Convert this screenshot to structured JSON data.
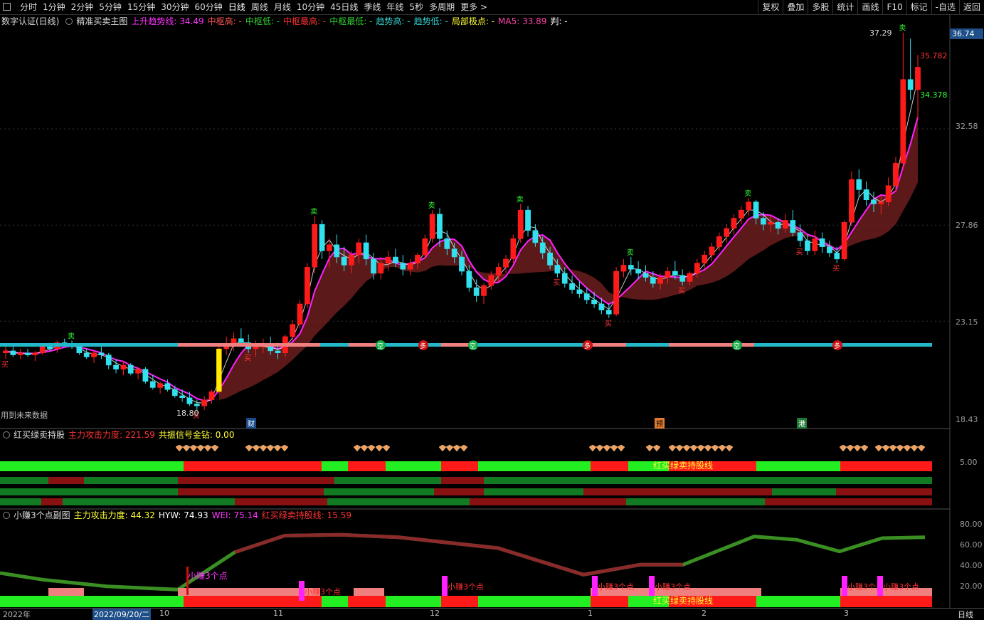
{
  "toolbar": {
    "timeframes": [
      "分时",
      "1分钟",
      "2分钟",
      "5分钟",
      "15分钟",
      "30分钟",
      "60分钟",
      "日线",
      "周线",
      "月线",
      "10分钟",
      "45日线",
      "季线",
      "年线",
      "5秒",
      "多周期",
      "更多 >"
    ],
    "active": "日线",
    "right_items": [
      "复权",
      "叠加",
      "多股",
      "统计",
      "画线",
      "F10",
      "标记",
      "-自选",
      "返回"
    ]
  },
  "main_header": {
    "stock": "数字认证(日线)",
    "indicator": "精准买卖主图",
    "fields": [
      {
        "label": "上升趋势线: 34.49",
        "color": "#ff33ff"
      },
      {
        "label": "中枢高: -",
        "color": "#ff5555"
      },
      {
        "label": "中枢低: -",
        "color": "#33cc33"
      },
      {
        "label": "中枢最高: -",
        "color": "#ff3333"
      },
      {
        "label": "中枢最低: -",
        "color": "#33cc33"
      },
      {
        "label": "趋势高: -",
        "color": "#33cccc"
      },
      {
        "label": "趋势低: -",
        "color": "#33cccc"
      },
      {
        "label": "局部极点: -",
        "color": "#ffff33"
      },
      {
        "label": "MA5: 33.89",
        "color": "#ff44aa"
      },
      {
        "label": "判: -",
        "color": "#ffffff"
      }
    ]
  },
  "main_axis": {
    "current": "36.74",
    "ticks": [
      "32.58",
      "27.86",
      "23.15",
      "18.43"
    ],
    "high_label": "37.29",
    "low_label": "18.80",
    "level_1": "35.782",
    "level_2": "34.378"
  },
  "main_notes": {
    "future_data": "用到未来数据",
    "event_1": "财",
    "event_2": "预",
    "event_3": "港"
  },
  "signal_labels": {
    "buy": "买",
    "sell": "卖",
    "empty": "空",
    "long": "多"
  },
  "sub1_header": {
    "name": "红买绿卖持股",
    "f1": "主力攻击力度: 221.59",
    "f2": "共振信号金钻: 0.00",
    "axis": "5.00",
    "band_label": "红买绿卖持股线"
  },
  "sub2_header": {
    "name": "小赚3个点副图",
    "f1": "主力攻击力度: 44.32",
    "f2": "HYW: 74.93",
    "f3": "WEI: 75.14",
    "f4": "红买绿卖持股线: 15.59",
    "ticks": [
      "80.00",
      "60.00",
      "40.00",
      "20.00"
    ],
    "tag": "小赚3个点",
    "band_label": "红买绿卖持股线"
  },
  "date_bar": {
    "year": "2022年",
    "cursor": "2022/09/20/二",
    "months": [
      "10",
      "11",
      "12",
      "1",
      "2",
      "3"
    ],
    "right": "日线"
  },
  "chart_data": {
    "type": "candlestick",
    "ohlc": [
      [
        21.6,
        21.9,
        21.3,
        21.7
      ],
      [
        21.7,
        21.9,
        21.4,
        21.5
      ],
      [
        21.5,
        21.8,
        21.3,
        21.6
      ],
      [
        21.6,
        21.8,
        21.4,
        21.5
      ],
      [
        21.5,
        21.7,
        21.2,
        21.6
      ],
      [
        21.6,
        22.0,
        21.5,
        21.9
      ],
      [
        21.9,
        22.1,
        21.7,
        21.8
      ],
      [
        21.8,
        22.2,
        21.6,
        22.1
      ],
      [
        22.1,
        22.3,
        21.9,
        22.0
      ],
      [
        22.0,
        22.2,
        21.8,
        21.9
      ],
      [
        21.9,
        22.0,
        21.5,
        21.6
      ],
      [
        21.6,
        21.8,
        21.3,
        21.4
      ],
      [
        21.4,
        21.7,
        21.1,
        21.6
      ],
      [
        21.6,
        21.9,
        21.3,
        21.5
      ],
      [
        21.5,
        21.6,
        20.8,
        21.0
      ],
      [
        21.0,
        21.3,
        20.6,
        20.8
      ],
      [
        20.8,
        21.2,
        20.5,
        21.0
      ],
      [
        21.0,
        21.1,
        20.5,
        20.6
      ],
      [
        20.6,
        20.9,
        20.3,
        20.8
      ],
      [
        20.8,
        20.9,
        20.1,
        20.2
      ],
      [
        20.2,
        20.5,
        19.8,
        19.9
      ],
      [
        19.9,
        20.2,
        19.6,
        20.1
      ],
      [
        20.1,
        20.3,
        19.7,
        19.8
      ],
      [
        19.8,
        20.0,
        19.4,
        19.5
      ],
      [
        19.5,
        19.8,
        19.2,
        19.4
      ],
      [
        19.4,
        19.7,
        19.0,
        19.1
      ],
      [
        19.1,
        19.3,
        18.8,
        19.0
      ],
      [
        19.0,
        19.5,
        18.8,
        19.3
      ],
      [
        19.3,
        19.8,
        19.1,
        19.7
      ],
      [
        19.7,
        22.0,
        19.6,
        21.8
      ],
      [
        21.8,
        22.4,
        21.5,
        22.0
      ],
      [
        22.0,
        22.6,
        21.7,
        22.3
      ],
      [
        22.3,
        22.8,
        21.9,
        22.1
      ],
      [
        22.1,
        22.5,
        21.6,
        21.8
      ],
      [
        21.8,
        22.2,
        21.4,
        21.9
      ],
      [
        21.9,
        22.3,
        21.6,
        22.0
      ],
      [
        22.0,
        22.4,
        21.5,
        21.7
      ],
      [
        21.7,
        22.1,
        21.3,
        21.6
      ],
      [
        21.6,
        22.5,
        21.4,
        22.4
      ],
      [
        22.4,
        23.2,
        22.2,
        23.0
      ],
      [
        23.0,
        24.2,
        22.8,
        24.0
      ],
      [
        24.0,
        26.0,
        23.8,
        25.8
      ],
      [
        25.8,
        28.3,
        25.5,
        27.9
      ],
      [
        27.9,
        28.1,
        26.2,
        26.6
      ],
      [
        26.6,
        27.2,
        25.8,
        26.9
      ],
      [
        26.9,
        27.4,
        26.0,
        26.3
      ],
      [
        26.3,
        26.8,
        25.6,
        25.9
      ],
      [
        25.9,
        26.6,
        25.5,
        26.4
      ],
      [
        26.4,
        27.2,
        26.0,
        27.0
      ],
      [
        27.0,
        27.4,
        25.9,
        26.2
      ],
      [
        26.2,
        26.5,
        25.2,
        25.5
      ],
      [
        25.5,
        26.3,
        25.2,
        26.0
      ],
      [
        26.0,
        26.6,
        25.6,
        26.3
      ],
      [
        26.3,
        26.7,
        25.8,
        26.0
      ],
      [
        26.0,
        26.4,
        25.4,
        25.7
      ],
      [
        25.7,
        26.2,
        25.4,
        26.0
      ],
      [
        26.0,
        26.5,
        25.7,
        26.4
      ],
      [
        26.4,
        27.4,
        26.2,
        27.2
      ],
      [
        27.2,
        28.6,
        27.0,
        28.4
      ],
      [
        28.4,
        28.7,
        26.8,
        27.2
      ],
      [
        27.2,
        27.6,
        26.4,
        26.7
      ],
      [
        26.7,
        27.0,
        26.0,
        26.3
      ],
      [
        26.3,
        26.6,
        25.4,
        25.6
      ],
      [
        25.6,
        25.9,
        24.6,
        24.8
      ],
      [
        24.8,
        25.2,
        24.1,
        24.4
      ],
      [
        24.4,
        25.0,
        24.0,
        24.9
      ],
      [
        24.9,
        25.6,
        24.7,
        25.4
      ],
      [
        25.4,
        26.0,
        25.1,
        25.8
      ],
      [
        25.8,
        26.4,
        25.5,
        26.2
      ],
      [
        26.2,
        27.4,
        26.0,
        27.2
      ],
      [
        27.2,
        28.9,
        27.0,
        28.6
      ],
      [
        28.6,
        28.8,
        27.3,
        27.6
      ],
      [
        27.6,
        27.9,
        26.8,
        27.0
      ],
      [
        27.0,
        27.3,
        26.2,
        26.5
      ],
      [
        26.5,
        26.8,
        25.7,
        25.9
      ],
      [
        25.9,
        26.2,
        25.3,
        25.5
      ],
      [
        25.5,
        25.8,
        24.8,
        25.0
      ],
      [
        25.0,
        25.4,
        24.5,
        24.7
      ],
      [
        24.7,
        25.1,
        24.3,
        24.5
      ],
      [
        24.5,
        24.8,
        24.0,
        24.2
      ],
      [
        24.2,
        24.6,
        23.8,
        24.0
      ],
      [
        24.0,
        24.3,
        23.5,
        23.7
      ],
      [
        23.7,
        24.0,
        23.3,
        23.5
      ],
      [
        23.5,
        25.8,
        23.4,
        25.6
      ],
      [
        25.6,
        26.2,
        25.3,
        25.9
      ],
      [
        25.9,
        26.3,
        25.4,
        25.7
      ],
      [
        25.7,
        26.1,
        25.2,
        25.5
      ],
      [
        25.5,
        25.9,
        25.1,
        25.3
      ],
      [
        25.3,
        25.6,
        24.8,
        25.0
      ],
      [
        25.0,
        25.5,
        24.7,
        25.3
      ],
      [
        25.3,
        25.8,
        25.0,
        25.6
      ],
      [
        25.6,
        26.1,
        25.2,
        25.4
      ],
      [
        25.4,
        25.7,
        24.9,
        25.1
      ],
      [
        25.1,
        25.6,
        24.9,
        25.5
      ],
      [
        25.5,
        26.2,
        25.3,
        26.0
      ],
      [
        26.0,
        26.6,
        25.7,
        26.4
      ],
      [
        26.4,
        27.0,
        26.1,
        26.8
      ],
      [
        26.8,
        27.5,
        26.6,
        27.3
      ],
      [
        27.3,
        27.9,
        27.0,
        27.7
      ],
      [
        27.7,
        28.4,
        27.4,
        28.2
      ],
      [
        28.2,
        28.8,
        27.9,
        28.6
      ],
      [
        28.6,
        29.2,
        28.3,
        29.0
      ],
      [
        29.0,
        29.1,
        27.9,
        28.2
      ],
      [
        28.2,
        28.5,
        27.6,
        27.9
      ],
      [
        27.9,
        28.3,
        27.5,
        28.0
      ],
      [
        28.0,
        28.2,
        27.4,
        27.7
      ],
      [
        27.7,
        28.4,
        27.5,
        28.1
      ],
      [
        28.1,
        28.6,
        27.3,
        27.5
      ],
      [
        27.5,
        27.9,
        26.8,
        27.1
      ],
      [
        27.1,
        27.4,
        26.4,
        26.6
      ],
      [
        26.6,
        27.6,
        26.4,
        27.2
      ],
      [
        27.2,
        27.5,
        26.5,
        26.8
      ],
      [
        26.8,
        27.1,
        26.3,
        26.5
      ],
      [
        26.5,
        26.8,
        26.0,
        26.2
      ],
      [
        26.2,
        28.1,
        26.1,
        28.0
      ],
      [
        28.0,
        30.5,
        27.8,
        30.1
      ],
      [
        30.1,
        30.6,
        29.2,
        29.6
      ],
      [
        29.6,
        30.0,
        28.8,
        29.1
      ],
      [
        29.1,
        29.5,
        28.5,
        28.9
      ],
      [
        28.9,
        29.3,
        28.4,
        29.0
      ],
      [
        29.0,
        30.2,
        28.8,
        29.8
      ],
      [
        29.8,
        31.2,
        29.5,
        30.9
      ],
      [
        30.9,
        37.3,
        30.6,
        35.0
      ],
      [
        35.0,
        37.0,
        34.0,
        34.5
      ],
      [
        34.5,
        36.2,
        33.0,
        35.6
      ]
    ]
  }
}
